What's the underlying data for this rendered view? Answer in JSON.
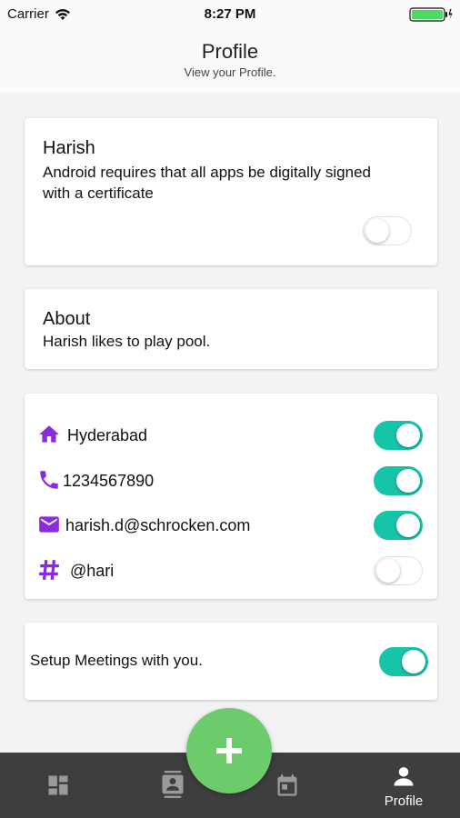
{
  "status_bar": {
    "carrier": "Carrier",
    "time": "8:27 PM",
    "icons": [
      "wifi-icon",
      "battery-icon"
    ],
    "battery_color": "#4cd964"
  },
  "header": {
    "title": "Profile",
    "subtitle": "View your Profile."
  },
  "profile_card": {
    "name": "Harish",
    "description": "Android requires that all apps be digitally signed with a certificate",
    "toggle_on": false
  },
  "about_card": {
    "title": "About",
    "text": "Harish likes to play pool."
  },
  "contacts": [
    {
      "icon": "home-icon",
      "text": "Hyderabad",
      "toggle_on": true
    },
    {
      "icon": "phone-icon",
      "text": "1234567890",
      "toggle_on": true
    },
    {
      "icon": "mail-icon",
      "text": "harish.d@schrocken.com",
      "toggle_on": true
    },
    {
      "icon": "hashtag-icon",
      "text": "@hari",
      "toggle_on": false
    }
  ],
  "meetings_card": {
    "text": "Setup Meetings with you.",
    "toggle_on": true
  },
  "fab": {
    "icon": "plus-icon",
    "color": "#6ccc6c"
  },
  "bottom_nav": {
    "items": [
      {
        "icon": "dashboard-icon",
        "label": ""
      },
      {
        "icon": "contacts-icon",
        "label": ""
      },
      {
        "icon": "calendar-icon",
        "label": ""
      },
      {
        "icon": "person-icon",
        "label": "Profile",
        "active": true
      }
    ]
  },
  "colors": {
    "accent_icon": "#8a2be2",
    "toggle_on": "#16c4a8",
    "nav_background": "#3e3e3e",
    "page_background": "#f3f3f6"
  }
}
